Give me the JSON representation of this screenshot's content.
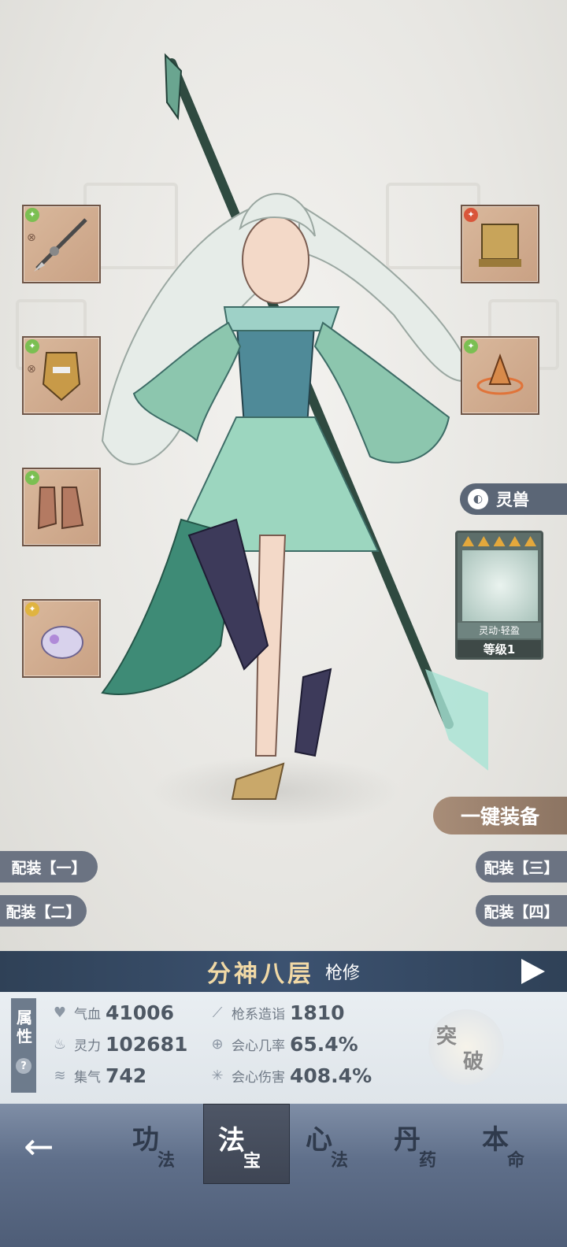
{
  "loadouts": {
    "one": "配装【一】",
    "two": "配装【二】",
    "three": "配装【三】",
    "four": "配装【四】"
  },
  "one_key_equip": "一键装备",
  "spirit_beast": {
    "tab_label": "灵兽",
    "stars": 5,
    "name": "灵动·轻盈",
    "level": "等级1"
  },
  "equipment_slots": {
    "left": [
      "spear-icon",
      "armor-icon",
      "boots-icon",
      "pendant-icon"
    ],
    "right": [
      "seal-icon",
      "crown-icon"
    ]
  },
  "title": {
    "realm": "分神八层",
    "class": "枪修"
  },
  "attributes": {
    "label": "属性",
    "help": "?",
    "hp": {
      "label": "气血",
      "value": "41006"
    },
    "spirit": {
      "label": "灵力",
      "value": "102681"
    },
    "qi": {
      "label": "集气",
      "value": "742"
    },
    "spear_mastery": {
      "label": "枪系造诣",
      "value": "1810"
    },
    "crit_rate": {
      "label": "会心几率",
      "value": "65.4%"
    },
    "crit_damage": {
      "label": "会心伤害",
      "value": "408.4%"
    }
  },
  "breakthrough": {
    "char1": "突",
    "char2": "破"
  },
  "nav": {
    "back": "←",
    "tabs": [
      {
        "big": "功",
        "small": "法"
      },
      {
        "big": "法",
        "small": "宝"
      },
      {
        "big": "心",
        "small": "法"
      },
      {
        "big": "丹",
        "small": "药"
      },
      {
        "big": "本",
        "small": "命"
      }
    ]
  },
  "colors": {
    "title_bar": "#2f4157",
    "realm_text": "#f1d9a6",
    "slot_bg": "#d9b89c",
    "pill_bg": "#6b7382",
    "nav_bg": "#5f6f8a"
  }
}
